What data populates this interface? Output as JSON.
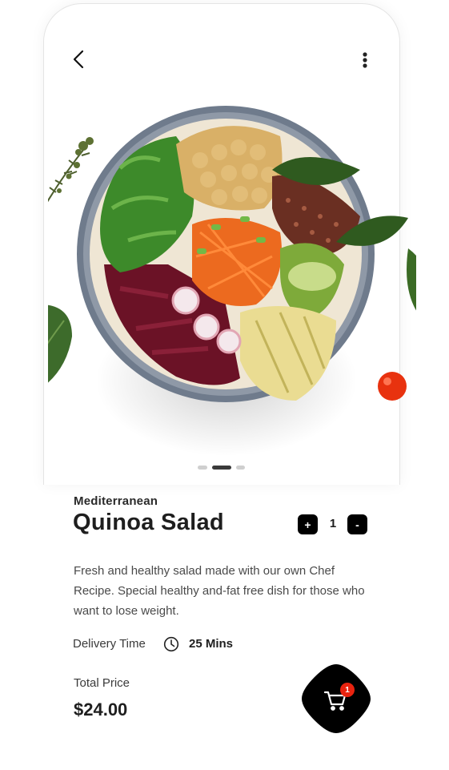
{
  "header": {
    "back_icon": "chevron-left-icon",
    "more_icon": "vertical-dots-icon"
  },
  "carousel": {
    "image": "quinoa-salad-bowl-photo",
    "pages": 3,
    "active_page": 2
  },
  "product": {
    "category": "Mediterranean",
    "name": "Quinoa Salad",
    "description": "Fresh and healthy salad made with our own Chef Recipe. Special healthy and-fat free dish for those who want to lose weight."
  },
  "quantity": {
    "plus_label": "+",
    "value": "1",
    "minus_label": "-"
  },
  "delivery": {
    "label": "Delivery Time",
    "icon": "clock-icon",
    "value": "25 Mins"
  },
  "price": {
    "label": "Total Price",
    "value": "$24.00"
  },
  "cart": {
    "icon": "cart-icon",
    "badge_count": "1"
  },
  "colors": {
    "accent": "#000000",
    "badge": "#e8230f",
    "text_primary": "#1e1e1e",
    "text_secondary": "#4a4a4a"
  }
}
